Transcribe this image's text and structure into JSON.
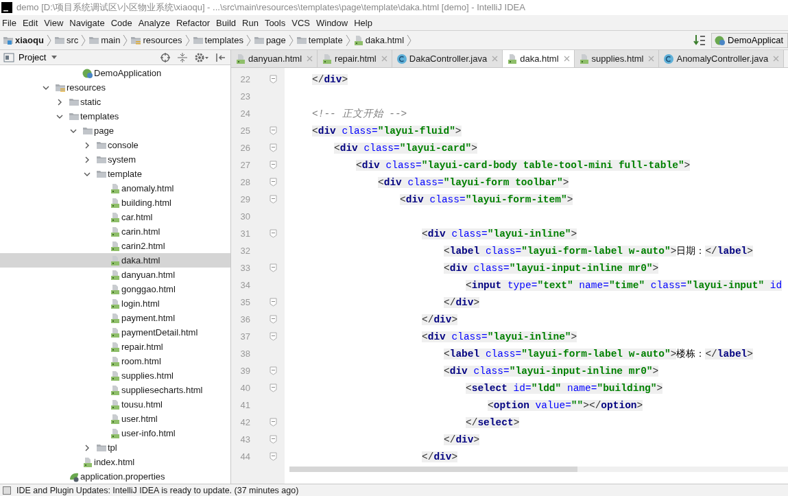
{
  "window": {
    "title": "demo [D:\\项目系统调试区\\小区物业系统\\xiaoqu] - ...\\src\\main\\resources\\templates\\page\\template\\daka.html [demo] - IntelliJ IDEA"
  },
  "menu": [
    "File",
    "Edit",
    "View",
    "Navigate",
    "Code",
    "Analyze",
    "Refactor",
    "Build",
    "Run",
    "Tools",
    "VCS",
    "Window",
    "Help"
  ],
  "breadcrumb": [
    {
      "label": "xiaoqu",
      "kind": "module"
    },
    {
      "label": "src",
      "kind": "folder"
    },
    {
      "label": "main",
      "kind": "folder"
    },
    {
      "label": "resources",
      "kind": "resources"
    },
    {
      "label": "templates",
      "kind": "folder"
    },
    {
      "label": "page",
      "kind": "folder"
    },
    {
      "label": "template",
      "kind": "folder"
    },
    {
      "label": "daka.html",
      "kind": "html"
    }
  ],
  "run_config": {
    "label": "DemoApplicat"
  },
  "project_panel": {
    "title": "Project",
    "tree_top": {
      "label": "DemoApplication",
      "kind": "spring"
    },
    "tree": [
      {
        "label": "resources",
        "kind": "resources",
        "expanded": true,
        "selected": false,
        "children": [
          {
            "label": "static",
            "kind": "folder",
            "expanded": false,
            "selected": false
          },
          {
            "label": "templates",
            "kind": "folder",
            "expanded": true,
            "selected": false,
            "children": [
              {
                "label": "page",
                "kind": "folder",
                "expanded": true,
                "selected": false,
                "children": [
                  {
                    "label": "console",
                    "kind": "folder",
                    "expanded": false,
                    "selected": false
                  },
                  {
                    "label": "system",
                    "kind": "folder",
                    "expanded": false,
                    "selected": false
                  },
                  {
                    "label": "template",
                    "kind": "folder",
                    "expanded": true,
                    "selected": false,
                    "children": [
                      {
                        "label": "anomaly.html",
                        "kind": "html",
                        "selected": false
                      },
                      {
                        "label": "building.html",
                        "kind": "html",
                        "selected": false
                      },
                      {
                        "label": "car.html",
                        "kind": "html",
                        "selected": false
                      },
                      {
                        "label": "carin.html",
                        "kind": "html",
                        "selected": false
                      },
                      {
                        "label": "carin2.html",
                        "kind": "html",
                        "selected": false
                      },
                      {
                        "label": "daka.html",
                        "kind": "html",
                        "selected": true
                      },
                      {
                        "label": "danyuan.html",
                        "kind": "html",
                        "selected": false
                      },
                      {
                        "label": "gonggao.html",
                        "kind": "html",
                        "selected": false
                      },
                      {
                        "label": "login.html",
                        "kind": "html",
                        "selected": false
                      },
                      {
                        "label": "payment.html",
                        "kind": "html",
                        "selected": false
                      },
                      {
                        "label": "paymentDetail.html",
                        "kind": "html",
                        "selected": false
                      },
                      {
                        "label": "repair.html",
                        "kind": "html",
                        "selected": false
                      },
                      {
                        "label": "room.html",
                        "kind": "html",
                        "selected": false
                      },
                      {
                        "label": "supplies.html",
                        "kind": "html",
                        "selected": false
                      },
                      {
                        "label": "suppliesecharts.html",
                        "kind": "html",
                        "selected": false
                      },
                      {
                        "label": "tousu.html",
                        "kind": "html",
                        "selected": false
                      },
                      {
                        "label": "user.html",
                        "kind": "html",
                        "selected": false
                      },
                      {
                        "label": "user-info.html",
                        "kind": "html",
                        "selected": false
                      }
                    ]
                  },
                  {
                    "label": "tpl",
                    "kind": "folder",
                    "expanded": false,
                    "selected": false
                  }
                ]
              },
              {
                "label": "index.html",
                "kind": "html",
                "selected": false
              }
            ]
          },
          {
            "label": "application.properties",
            "kind": "properties",
            "selected": false
          }
        ]
      }
    ]
  },
  "editor": {
    "tabs": [
      {
        "label": "danyuan.html",
        "kind": "html",
        "selected": false
      },
      {
        "label": "repair.html",
        "kind": "html",
        "selected": false
      },
      {
        "label": "DakaController.java",
        "kind": "class",
        "selected": false
      },
      {
        "label": "daka.html",
        "kind": "html",
        "selected": true
      },
      {
        "label": "supplies.html",
        "kind": "html",
        "selected": false
      },
      {
        "label": "AnomalyController.java",
        "kind": "class",
        "selected": false
      }
    ],
    "lines": [
      {
        "number": "22",
        "fold": true,
        "code": [
          {
            "kind": "punct",
            "text": "</"
          },
          {
            "kind": "tag",
            "text": "div"
          },
          {
            "kind": "punct",
            "text": ">"
          }
        ]
      },
      {
        "number": "23",
        "fold": false
      },
      {
        "number": "24",
        "fold": false,
        "code": [
          {
            "kind": "comment",
            "text": "<!-- 正文开始 -->"
          }
        ]
      },
      {
        "number": "25",
        "fold": true,
        "code": [
          {
            "kind": "punct",
            "text": "<"
          },
          {
            "kind": "tag",
            "text": "div"
          },
          {
            "kind": "attr",
            "text": " class="
          },
          {
            "kind": "string",
            "text": "\"layui-fluid\""
          },
          {
            "kind": "punct",
            "text": ">"
          }
        ],
        "children": [
          {
            "number": "26",
            "fold": true,
            "code": [
              {
                "kind": "punct",
                "text": "<"
              },
              {
                "kind": "tag",
                "text": "div"
              },
              {
                "kind": "attr",
                "text": " class="
              },
              {
                "kind": "string",
                "text": "\"layui-card\""
              },
              {
                "kind": "punct",
                "text": ">"
              }
            ],
            "children": [
              {
                "number": "27",
                "fold": true,
                "code": [
                  {
                    "kind": "punct",
                    "text": "<"
                  },
                  {
                    "kind": "tag",
                    "text": "div"
                  },
                  {
                    "kind": "attr",
                    "text": " class="
                  },
                  {
                    "kind": "string",
                    "text": "\"layui-card-body table-tool-mini full-table\""
                  },
                  {
                    "kind": "punct",
                    "text": ">"
                  }
                ],
                "children": [
                  {
                    "number": "28",
                    "fold": true,
                    "code": [
                      {
                        "kind": "punct",
                        "text": "<"
                      },
                      {
                        "kind": "tag",
                        "text": "div"
                      },
                      {
                        "kind": "attr",
                        "text": " class="
                      },
                      {
                        "kind": "string",
                        "text": "\"layui-form toolbar\""
                      },
                      {
                        "kind": "punct",
                        "text": ">"
                      }
                    ],
                    "children": [
                      {
                        "number": "29",
                        "fold": true,
                        "code": [
                          {
                            "kind": "punct",
                            "text": "<"
                          },
                          {
                            "kind": "tag",
                            "text": "div"
                          },
                          {
                            "kind": "attr",
                            "text": " class="
                          },
                          {
                            "kind": "string",
                            "text": "\"layui-form-item\""
                          },
                          {
                            "kind": "punct",
                            "text": ">"
                          }
                        ],
                        "children": [
                          {
                            "number": "30",
                            "fold": false
                          },
                          {
                            "number": "31",
                            "fold": true,
                            "code": [
                              {
                                "kind": "punct",
                                "text": "<"
                              },
                              {
                                "kind": "tag",
                                "text": "div"
                              },
                              {
                                "kind": "attr",
                                "text": " class="
                              },
                              {
                                "kind": "string",
                                "text": "\"layui-inline\""
                              },
                              {
                                "kind": "punct",
                                "text": ">"
                              }
                            ],
                            "children": [
                              {
                                "number": "32",
                                "fold": false,
                                "code": [
                                  {
                                    "kind": "punct",
                                    "text": "<"
                                  },
                                  {
                                    "kind": "tag",
                                    "text": "label"
                                  },
                                  {
                                    "kind": "attr",
                                    "text": " class="
                                  },
                                  {
                                    "kind": "string",
                                    "text": "\"layui-form-label w-auto\""
                                  },
                                  {
                                    "kind": "punct",
                                    "text": ">"
                                  },
                                  {
                                    "kind": "text",
                                    "text": "日期："
                                  },
                                  {
                                    "kind": "punct",
                                    "text": "</"
                                  },
                                  {
                                    "kind": "tag",
                                    "text": "label"
                                  },
                                  {
                                    "kind": "punct",
                                    "text": ">"
                                  }
                                ]
                              },
                              {
                                "number": "33",
                                "fold": true,
                                "code": [
                                  {
                                    "kind": "punct",
                                    "text": "<"
                                  },
                                  {
                                    "kind": "tag",
                                    "text": "div"
                                  },
                                  {
                                    "kind": "attr",
                                    "text": " class="
                                  },
                                  {
                                    "kind": "string",
                                    "text": "\"layui-input-inline mr0\""
                                  },
                                  {
                                    "kind": "punct",
                                    "text": ">"
                                  }
                                ],
                                "children": [
                                  {
                                    "number": "34",
                                    "fold": false,
                                    "code": [
                                      {
                                        "kind": "punct",
                                        "text": "<"
                                      },
                                      {
                                        "kind": "tag",
                                        "text": "input"
                                      },
                                      {
                                        "kind": "attr",
                                        "text": " type="
                                      },
                                      {
                                        "kind": "string",
                                        "text": "\"text\""
                                      },
                                      {
                                        "kind": "attr",
                                        "text": " name="
                                      },
                                      {
                                        "kind": "string",
                                        "text": "\"time\""
                                      },
                                      {
                                        "kind": "attr",
                                        "text": " class="
                                      },
                                      {
                                        "kind": "string",
                                        "text": "\"layui-input\""
                                      },
                                      {
                                        "kind": "attr",
                                        "text": " id"
                                      }
                                    ]
                                  }
                                ]
                              },
                              {
                                "number": "35",
                                "fold": true,
                                "code": [
                                  {
                                    "kind": "punct",
                                    "text": "</"
                                  },
                                  {
                                    "kind": "tag",
                                    "text": "div"
                                  },
                                  {
                                    "kind": "punct",
                                    "text": ">"
                                  }
                                ]
                              }
                            ]
                          },
                          {
                            "number": "36",
                            "fold": true,
                            "code": [
                              {
                                "kind": "punct",
                                "text": "</"
                              },
                              {
                                "kind": "tag",
                                "text": "div"
                              },
                              {
                                "kind": "punct",
                                "text": ">"
                              }
                            ]
                          },
                          {
                            "number": "37",
                            "fold": true,
                            "code": [
                              {
                                "kind": "punct",
                                "text": "<"
                              },
                              {
                                "kind": "tag",
                                "text": "div"
                              },
                              {
                                "kind": "attr",
                                "text": " class="
                              },
                              {
                                "kind": "string",
                                "text": "\"layui-inline\""
                              },
                              {
                                "kind": "punct",
                                "text": ">"
                              }
                            ],
                            "children": [
                              {
                                "number": "38",
                                "fold": false,
                                "code": [
                                  {
                                    "kind": "punct",
                                    "text": "<"
                                  },
                                  {
                                    "kind": "tag",
                                    "text": "label"
                                  },
                                  {
                                    "kind": "attr",
                                    "text": " class="
                                  },
                                  {
                                    "kind": "string",
                                    "text": "\"layui-form-label w-auto\""
                                  },
                                  {
                                    "kind": "punct",
                                    "text": ">"
                                  },
                                  {
                                    "kind": "text",
                                    "text": "楼栋："
                                  },
                                  {
                                    "kind": "punct",
                                    "text": "</"
                                  },
                                  {
                                    "kind": "tag",
                                    "text": "label"
                                  },
                                  {
                                    "kind": "punct",
                                    "text": ">"
                                  }
                                ]
                              },
                              {
                                "number": "39",
                                "fold": true,
                                "code": [
                                  {
                                    "kind": "punct",
                                    "text": "<"
                                  },
                                  {
                                    "kind": "tag",
                                    "text": "div"
                                  },
                                  {
                                    "kind": "attr",
                                    "text": " class="
                                  },
                                  {
                                    "kind": "string",
                                    "text": "\"layui-input-inline mr0\""
                                  },
                                  {
                                    "kind": "punct",
                                    "text": ">"
                                  }
                                ],
                                "children": [
                                  {
                                    "number": "40",
                                    "fold": true,
                                    "code": [
                                      {
                                        "kind": "punct",
                                        "text": "<"
                                      },
                                      {
                                        "kind": "tag",
                                        "text": "select"
                                      },
                                      {
                                        "kind": "attr",
                                        "text": " id="
                                      },
                                      {
                                        "kind": "string",
                                        "text": "\"ldd\""
                                      },
                                      {
                                        "kind": "attr",
                                        "text": " name="
                                      },
                                      {
                                        "kind": "string",
                                        "text": "\"building\""
                                      },
                                      {
                                        "kind": "punct",
                                        "text": ">"
                                      }
                                    ],
                                    "children": [
                                      {
                                        "number": "41",
                                        "fold": false,
                                        "code": [
                                          {
                                            "kind": "punct",
                                            "text": "<"
                                          },
                                          {
                                            "kind": "tag",
                                            "text": "option"
                                          },
                                          {
                                            "kind": "attr",
                                            "text": " value="
                                          },
                                          {
                                            "kind": "string",
                                            "text": "\"\""
                                          },
                                          {
                                            "kind": "punct",
                                            "text": "></"
                                          },
                                          {
                                            "kind": "tag",
                                            "text": "option"
                                          },
                                          {
                                            "kind": "punct",
                                            "text": ">"
                                          }
                                        ]
                                      }
                                    ]
                                  },
                                  {
                                    "number": "42",
                                    "fold": true,
                                    "code": [
                                      {
                                        "kind": "punct",
                                        "text": "</"
                                      },
                                      {
                                        "kind": "tag",
                                        "text": "select"
                                      },
                                      {
                                        "kind": "punct",
                                        "text": ">"
                                      }
                                    ]
                                  }
                                ]
                              },
                              {
                                "number": "43",
                                "fold": true,
                                "code": [
                                  {
                                    "kind": "punct",
                                    "text": "</"
                                  },
                                  {
                                    "kind": "tag",
                                    "text": "div"
                                  },
                                  {
                                    "kind": "punct",
                                    "text": ">"
                                  }
                                ]
                              }
                            ]
                          },
                          {
                            "number": "44",
                            "fold": true,
                            "code": [
                              {
                                "kind": "punct",
                                "text": "</"
                              },
                              {
                                "kind": "tag",
                                "text": "div"
                              },
                              {
                                "kind": "punct",
                                "text": ">"
                              }
                            ]
                          }
                        ]
                      }
                    ]
                  }
                ]
              }
            ]
          }
        ]
      }
    ]
  },
  "status_bar": {
    "message": "IDE and Plugin Updates: IntelliJ IDEA is ready to update. (37 minutes ago)"
  }
}
